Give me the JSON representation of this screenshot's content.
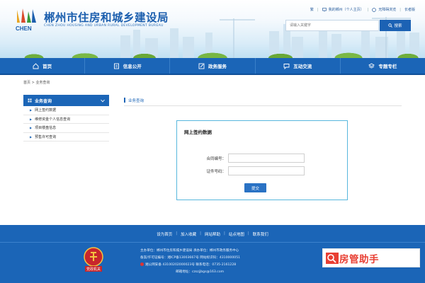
{
  "header": {
    "site_title": "郴州市住房和城乡建设局",
    "site_subtitle": "CHEN ZHOU HOUSING AND URBAN RURAL DEVELOPMENT BUREAU",
    "logo_text": "CHEN",
    "top_links": {
      "traditional": "繁",
      "my_chenzhou": "我的郴州（个人主页）",
      "accessibility": "无障碍浏览",
      "elderly": "长者版"
    },
    "search": {
      "placeholder": "请输入关键字",
      "button_label": "搜索"
    }
  },
  "nav": {
    "items": [
      {
        "label": "首页",
        "icon": "home-icon"
      },
      {
        "label": "信息公开",
        "icon": "document-icon"
      },
      {
        "label": "政务服务",
        "icon": "edit-icon"
      },
      {
        "label": "互动交流",
        "icon": "chat-icon"
      },
      {
        "label": "专题专栏",
        "icon": "layers-icon"
      }
    ]
  },
  "breadcrumb": {
    "home": "首页",
    "separator": ">",
    "current": "业务查询"
  },
  "sidebar": {
    "title": "业务查询",
    "items": [
      {
        "label": "网上签约数据"
      },
      {
        "label": "维修资金个人信息查询"
      },
      {
        "label": "项目楼盘信息"
      },
      {
        "label": "预售许可查询"
      }
    ]
  },
  "main": {
    "section_title": "业务查询",
    "panel": {
      "title": "网上签约数据",
      "contract_label": "合同编号：",
      "contract_value": "",
      "id_label": "证件号码：",
      "id_value": "",
      "submit_label": "提交"
    }
  },
  "footer": {
    "links": [
      "设为首页",
      "加入收藏",
      "网站帮助",
      "站点地图",
      "联系我们"
    ],
    "separator": "|",
    "host": "主办单位：郴州市住房和城乡建设局    承办单位：郴州市政务服务中心",
    "icp": "备案/许可证编号：湘ICP备13003667号    网站标识码：4310000051",
    "police": "湘公网安备 43100202000023号    联系电话：0735-2161228",
    "email": "邮箱地址：czszjjbgs@163.com",
    "badge_text": "党政机关",
    "brand_text": "房管助手"
  },
  "colors": {
    "primary": "#1b65b7",
    "panel_border": "#58b7dd",
    "brand_red": "#e83f33"
  }
}
